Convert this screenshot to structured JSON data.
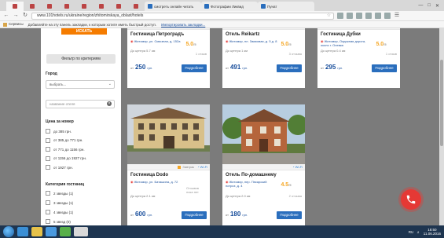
{
  "browser": {
    "tabs": [
      {
        "label": "",
        "type": "mini"
      },
      {
        "label": "",
        "type": "mini"
      },
      {
        "label": "",
        "type": "mini"
      },
      {
        "label": "",
        "type": "mini"
      },
      {
        "label": "",
        "type": "mini"
      },
      {
        "label": "",
        "type": "mini"
      },
      {
        "label": "",
        "type": "mini"
      },
      {
        "label": "",
        "type": "mini"
      },
      {
        "label": "смотреть онлайн читать",
        "type": "wide"
      },
      {
        "label": "Фотографии Ликвид",
        "type": "wide"
      },
      {
        "label": "Пунат",
        "type": "wide"
      }
    ],
    "url": "www.101hotels.ru/ukraine/region/zhitomirskaya_oblast/hotels",
    "bookmarks": {
      "services": "Сервисы",
      "hint": "Добавляйте на эту панель закладки, к которым хотите иметь быстрый доступ.",
      "import_link": "Импортировать закладки..."
    }
  },
  "sidebar": {
    "top_button": "ИСКАТЬ",
    "filter_button": "Фильтр по критериям",
    "city_label": "Город",
    "city_select": "выбрать...",
    "hotel_search_placeholder": "название отеля",
    "price_label": "Цена за номер",
    "price_options": [
      "до 385 грн.",
      "от 385 до 771 грн.",
      "от 771 до 1156 грн.",
      "от 1156 до 1927 грн.",
      "от 1927 грн."
    ],
    "category_label": "Категория гостиниц",
    "category_options": [
      "2 звезды (1)",
      "3 звезды (1)",
      "4 звезды (1)",
      "5 звезд (0)"
    ]
  },
  "hotels": [
    {
      "name": "Гостиница Петроградъ",
      "stars": "★★☆☆☆",
      "address": "Житомир, ул. Сквозная, д. 152а",
      "distance": "До центра 5.7 км",
      "score": "5.0",
      "score_max": "5",
      "reviews": "1 отзыв",
      "price_from": "от",
      "price": "250",
      "currency": "грн.",
      "more": "Подробнее",
      "badge": "",
      "wifi": "Wi-Fi"
    },
    {
      "name": "Отель Reikartz",
      "stars": "★★★★☆",
      "address": "Житомир, пл. Замковая, д. 5 д. 8",
      "distance": "До центра 1 км",
      "score": "5.0",
      "score_max": "5",
      "reviews": "3 отзыва",
      "price_from": "от",
      "price": "491",
      "currency": "грн.",
      "more": "Подробнее",
      "badge": "Завтрак",
      "wifi": "Wi-Fi"
    },
    {
      "name": "Гостиница Дубки",
      "stars": "★★☆☆☆",
      "address": "Житомир, Окружная дорога, около г. Олевка",
      "distance": "До центра 0.4 км",
      "score": "5.0",
      "score_max": "5",
      "reviews": "1 отзыв",
      "price_from": "от",
      "price": "295",
      "currency": "грн.",
      "more": "Подробнее",
      "badge": "Завтрак",
      "wifi": "Wi-Fi"
    },
    {
      "name": "Гостиница Dodo",
      "stars": "",
      "address": "Житомир, ул. Баташина, д. 72",
      "distance": "До центра 2.1 км",
      "score": "",
      "score_max": "",
      "reviews": "Отзывов пока нет",
      "price_from": "от",
      "price": "600",
      "currency": "грн.",
      "more": "Подробнее",
      "badge": "Завтрак",
      "wifi": "Wi-Fi"
    },
    {
      "name": "Отель По-домашнему",
      "stars": "",
      "address": "Житомир, пер. Пекарский потрсэ, д. 4",
      "distance": "До центра 2.0 км",
      "score": "4.5",
      "score_max": "5",
      "reviews": "2 отзыва",
      "price_from": "от",
      "price": "180",
      "currency": "грн.",
      "more": "Подробнее",
      "badge": "",
      "wifi": "Wi-Fi"
    }
  ],
  "taskbar": {
    "lang": "RU",
    "time": "18:50",
    "date": "11.06.2016"
  },
  "colors": {
    "accent": "#2a6ebd",
    "orange": "#f57c00",
    "star": "#f5a623",
    "fab": "#e53935"
  }
}
